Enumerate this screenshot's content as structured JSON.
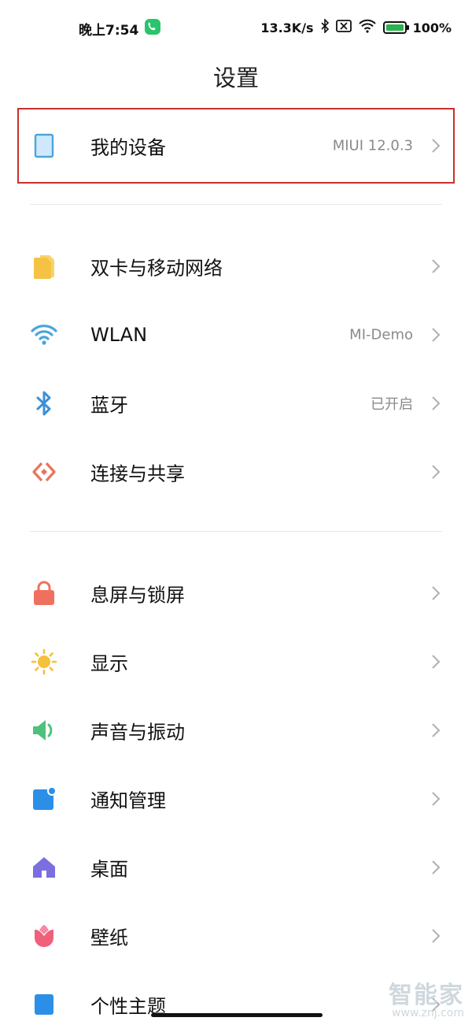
{
  "status_bar": {
    "time": "晚上7:54",
    "net_speed": "13.3K/s",
    "battery": "100%"
  },
  "header": {
    "title": "设置"
  },
  "device": {
    "label": "我的设备",
    "value": "MIUI 12.0.3",
    "icon": "tablet-icon"
  },
  "group1": [
    {
      "label": "双卡与移动网络",
      "value": "",
      "icon": "sim-card-icon"
    },
    {
      "label": "WLAN",
      "value": "MI-Demo",
      "icon": "wifi-icon"
    },
    {
      "label": "蓝牙",
      "value": "已开启",
      "icon": "bluetooth-icon"
    },
    {
      "label": "连接与共享",
      "value": "",
      "icon": "share-connection-icon"
    }
  ],
  "group2": [
    {
      "label": "息屏与锁屏",
      "value": "",
      "icon": "lock-icon"
    },
    {
      "label": "显示",
      "value": "",
      "icon": "sun-icon"
    },
    {
      "label": "声音与振动",
      "value": "",
      "icon": "speaker-icon"
    },
    {
      "label": "通知管理",
      "value": "",
      "icon": "notification-icon"
    },
    {
      "label": "桌面",
      "value": "",
      "icon": "home-icon"
    },
    {
      "label": "壁纸",
      "value": "",
      "icon": "flower-icon"
    },
    {
      "label": "个性主题",
      "value": "",
      "icon": "theme-icon"
    }
  ],
  "watermark": {
    "title": "智能家",
    "url": "www.znj.com"
  },
  "colors": {
    "highlight_border": "#c9302c",
    "sim": "#f5c344",
    "wifi": "#4aa6d9",
    "bluetooth": "#3c8fd6",
    "share": "#e8745a",
    "lock": "#f0705e",
    "sun": "#f5c03a",
    "speaker": "#4ec27d",
    "notification": "#2b8fe8",
    "home": "#7b6fe0",
    "flower": "#f0607a"
  }
}
